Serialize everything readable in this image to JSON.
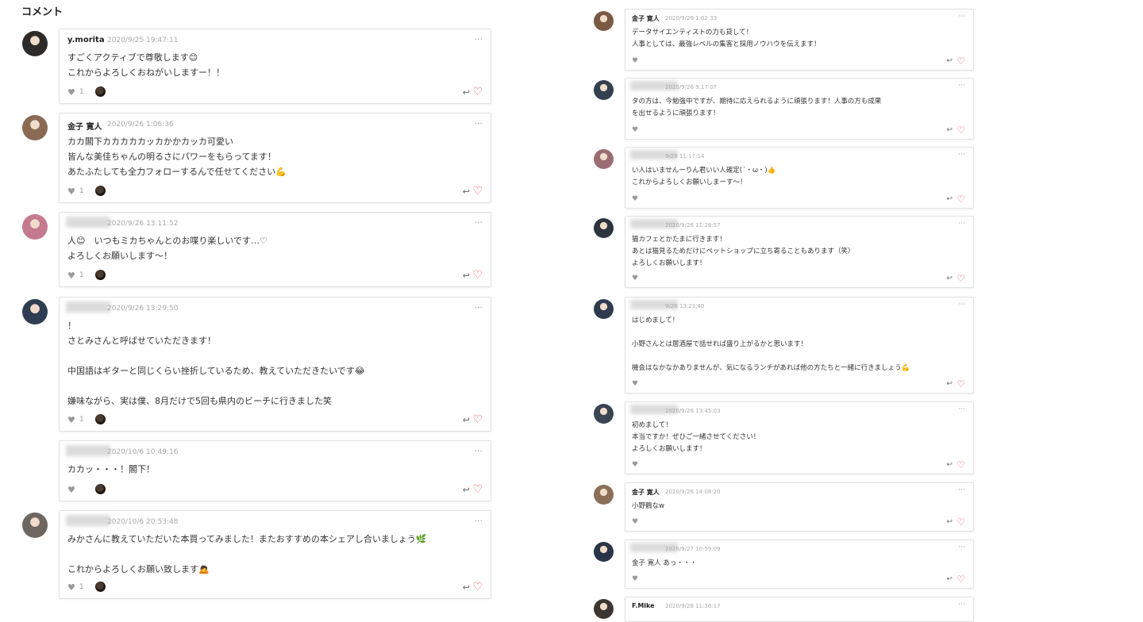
{
  "section_title": "コメント",
  "left_comments": [
    {
      "author": "y.morita",
      "timestamp": "2020/9/25 19:47:11",
      "lines": [
        "すごくアクティブで尊敬します😊",
        "これからよろしくおねがいしますー！！"
      ],
      "like_count": "1"
    },
    {
      "author": "金子 寛人",
      "timestamp": "2020/9/26 1:06:36",
      "lines": [
        "カカ閣下カカカカカッカかかカッカ可愛い",
        "皆んな美佳ちゃんの明るさにパワーをもらってます！",
        "あたふたしても全力フォローするんで任せてください💪"
      ],
      "like_count": "1"
    },
    {
      "author": "",
      "timestamp": "2020/9/26 13:11:52",
      "lines": [
        "人😊　いつもミカちゃんとのお喋り楽しいです…♡",
        "よろしくお願いします〜！"
      ],
      "like_count": "1"
    },
    {
      "author": "",
      "timestamp": "2020/9/26 13:29:50",
      "lines": [
        "！",
        "さとみさんと呼ばせていただきます！",
        "",
        "中国語はギターと同じくらい挫折しているため、教えていただきたいです😂",
        "",
        "嫌味ながら、実は僕、8月だけで5回も県内のビーチに行きました笑"
      ],
      "like_count": "1"
    },
    {
      "author": "",
      "timestamp": "2020/10/6 10:49:16",
      "lines": [
        "カカッ・・・！閣下！"
      ],
      "like_count": ""
    },
    {
      "author": "",
      "timestamp": "2020/10/6 20:53:48",
      "lines": [
        "みかさんに教えていただいた本買ってみました！またおすすめの本シェアし合いましょう🌿",
        "",
        "これからよろしくお願い致します🙇"
      ],
      "like_count": "1"
    }
  ],
  "right_comments": [
    {
      "author": "金子 寛人",
      "timestamp": "2020/9/26 1:02:33",
      "lines": [
        "データサイエンティストの力も貸して！",
        "人事としては、最強レベルの集客と採用ノウハウを伝えます！"
      ]
    },
    {
      "author": "",
      "timestamp": "2020/9/26 9:17:07",
      "lines": [
        "タの方は、今勉強中ですが、期待に応えられるように頑張ります！人事の方も成果",
        "を出せるように頑張ります！"
      ]
    },
    {
      "author": "",
      "timestamp": "9/26 11:17:14",
      "lines": [
        "い人はいませんーりん君いい人確定(´・ω・)👍",
        "これからよろしくお願いしまーす〜！"
      ]
    },
    {
      "author": "",
      "timestamp": "2020/9/26 11:28:57",
      "lines": [
        "猫カフェとかたまに行きます！",
        "あとは猫見るためだけにペットショップに立ち寄ることもあります（笑）",
        "よろしくお願いします！"
      ]
    },
    {
      "author": "",
      "timestamp": "9/26 13:23:40",
      "lines": [
        "はじめまして！",
        "",
        "小野さんとは居酒屋で話せれば盛り上がるかと思います！",
        "",
        "機会はなかなかありませんが、気になるランチがあれば他の方たちと一緒に行きましょう💪"
      ]
    },
    {
      "author": "",
      "timestamp": "2020/9/26 13:45:03",
      "lines": [
        "初めまして！",
        "本当ですか！ぜひご一緒させてください！",
        "よろしくお願いします！"
      ]
    },
    {
      "author": "金子 寛人",
      "timestamp": "2020/9/26 14:08:20",
      "lines": [
        "小野鶴なw"
      ]
    },
    {
      "author": "",
      "timestamp": "2020/9/27 10:59:09",
      "lines": [
        "金子 寛人 あっ・・・"
      ]
    },
    {
      "author": "F.Mike",
      "timestamp": "2020/9/28 11:36:17",
      "lines": []
    }
  ],
  "icons": {
    "more": "ellipsis-icon",
    "like": "heart-gray-icon",
    "reply": "reply-arrow-icon",
    "favorite": "heart-outline-red-icon"
  },
  "symbols": {
    "more": "···",
    "like": "♥",
    "reply": "↩",
    "favorite": "♡"
  },
  "colors": {
    "accent_heart": "#e24848",
    "card_border": "#e1e1e1",
    "timestamp": "#a8a8a8"
  }
}
